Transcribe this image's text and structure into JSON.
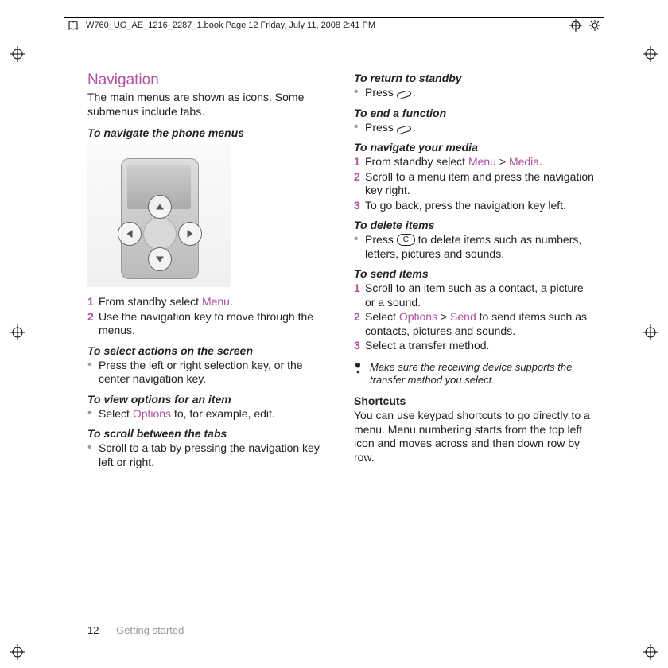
{
  "header": {
    "text": "W760_UG_AE_1216_2287_1.book  Page 12  Friday, July 11, 2008  2:41 PM"
  },
  "left": {
    "section_title": "Navigation",
    "intro": "The main menus are shown as icons. Some submenus include tabs.",
    "h_nav_menus": "To navigate the phone menus",
    "step1_pre": "From standby select ",
    "step1_link": "Menu",
    "step1_post": ".",
    "step2": "Use the navigation key to move through the menus.",
    "h_select_actions": "To select actions on the screen",
    "b_select_actions": "Press the left or right selection key, or the center navigation key.",
    "h_view_options": "To view options for an item",
    "b_view_options_pre": "Select ",
    "b_view_options_link": "Options",
    "b_view_options_post": " to, for example, edit.",
    "h_scroll_tabs": "To scroll between the tabs",
    "b_scroll_tabs": "Scroll to a tab by pressing the navigation key left or right."
  },
  "right": {
    "h_return": "To return to standby",
    "b_return_pre": "Press ",
    "b_return_post": ".",
    "h_end": "To end a function",
    "b_end_pre": "Press ",
    "b_end_post": ".",
    "h_nav_media": "To navigate your media",
    "m1_pre": "From standby select ",
    "m1_link1": "Menu",
    "m1_sep": " > ",
    "m1_link2": "Media",
    "m1_post": ".",
    "m2": "Scroll to a menu item and press the navigation key right.",
    "m3": "To go back, press the navigation key left.",
    "h_delete": "To delete items",
    "b_delete_pre": "Press ",
    "b_delete_key": "C",
    "b_delete_post": " to delete items such as numbers, letters, pictures and sounds.",
    "h_send": "To send items",
    "s1": "Scroll to an item such as a contact, a picture or a sound.",
    "s2_pre": "Select ",
    "s2_link1": "Options",
    "s2_sep": " > ",
    "s2_link2": "Send",
    "s2_post": " to send items such as contacts, pictures and sounds.",
    "s3": "Select a transfer method.",
    "note": "Make sure the receiving device supports the transfer method you select.",
    "h_shortcuts": "Shortcuts",
    "b_shortcuts": "You can use keypad shortcuts to go directly to a menu. Menu numbering starts from the top left icon and moves across and then down row by row."
  },
  "footer": {
    "page": "12",
    "section": "Getting started"
  },
  "nums": {
    "n1": "1",
    "n2": "2",
    "n3": "3"
  }
}
